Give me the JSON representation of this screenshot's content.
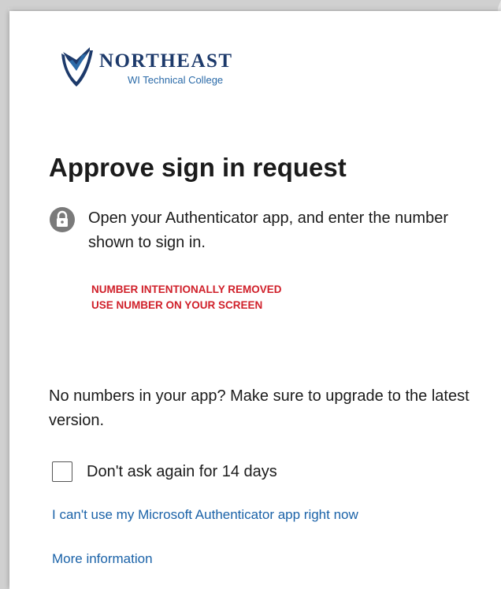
{
  "logo": {
    "name": "NORTHEAST",
    "subtitle": "WI Technical College",
    "icon": "shield-check-icon",
    "colors": {
      "navy": "#1d3a6b",
      "blue": "#2a6aa8"
    }
  },
  "title": "Approve sign in request",
  "instruction": {
    "icon": "lock-icon",
    "text": "Open your Authenticator app, and enter the number shown to sign in."
  },
  "notice": {
    "line1": "NUMBER INTENTIONALLY REMOVED",
    "line2": "USE NUMBER ON YOUR SCREEN",
    "color": "#d0202a"
  },
  "upgrade_text": "No numbers in your app? Make sure to upgrade to the latest version.",
  "remember": {
    "label": "Don't ask again for 14 days",
    "checked": false
  },
  "links": {
    "cant_use": "I can't use my Microsoft Authenticator app right now",
    "more_info": "More information",
    "color": "#1a62a8"
  }
}
